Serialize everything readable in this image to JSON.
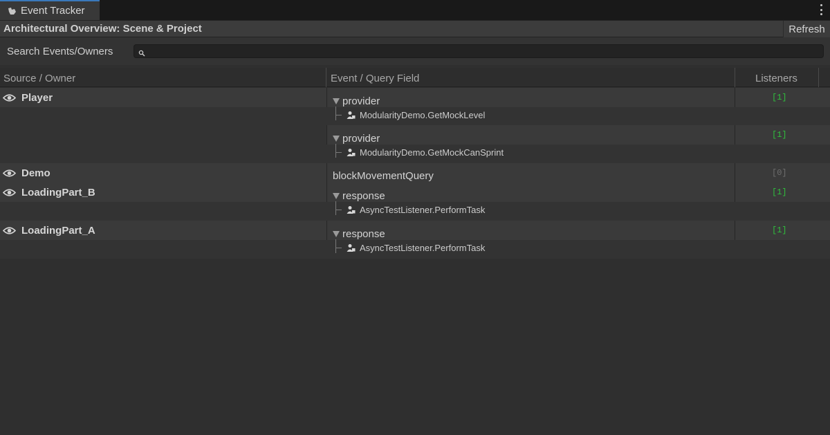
{
  "window": {
    "tab_title": "Event Tracker",
    "tab_icon": "tracker-hand-icon",
    "menu_icon": "kebab-menu-icon"
  },
  "toolbar": {
    "title": "Architectural Overview: Scene & Project",
    "refresh_label": "Refresh"
  },
  "search": {
    "label": "Search Events/Owners",
    "value": "",
    "icon": "search-icon"
  },
  "columns": {
    "owner": "Source / Owner",
    "field": "Event / Query Field",
    "listeners": "Listeners"
  },
  "rows": [
    {
      "owner": "Player",
      "entries": [
        {
          "field": "provider",
          "listener": "ModularityDemo.GetMockLevel",
          "count": "[1]"
        },
        {
          "field": "provider",
          "listener": "ModularityDemo.GetMockCanSprint",
          "count": "[1]"
        }
      ]
    },
    {
      "owner": "Demo",
      "entries": [
        {
          "field": "blockMovementQuery",
          "count": "[0]"
        }
      ]
    },
    {
      "owner": "LoadingPart_B",
      "entries": [
        {
          "field": "response",
          "listener": "AsyncTestListener.PerformTask",
          "count": "[1]"
        }
      ]
    },
    {
      "owner": "LoadingPart_A",
      "entries": [
        {
          "field": "response",
          "listener": "AsyncTestListener.PerformTask",
          "count": "[1]"
        }
      ]
    }
  ],
  "colors": {
    "active_count": "#2fbf3c",
    "zero_count": "#6e6e6e",
    "tab_accent": "#3a79bb"
  }
}
